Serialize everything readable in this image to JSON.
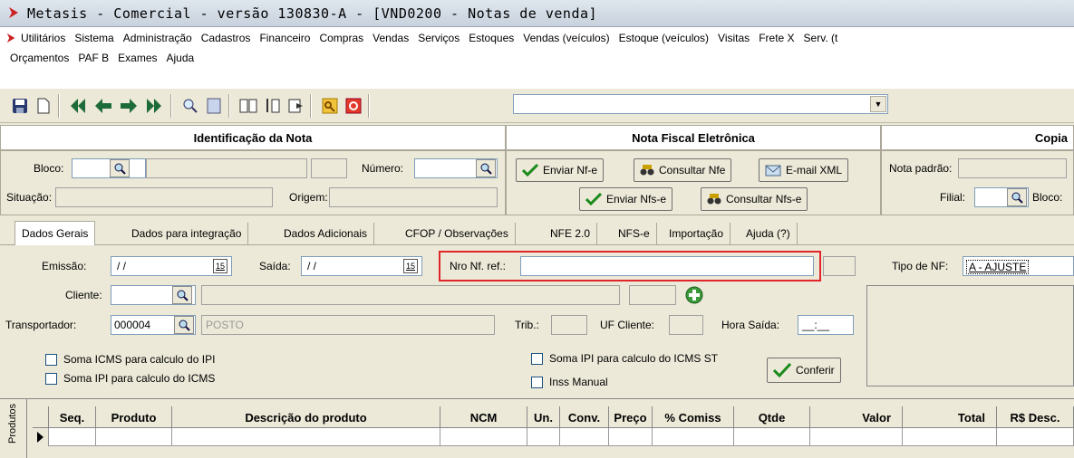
{
  "window": {
    "title": "Metasis - Comercial - versão 130830-A - [VND0200 - Notas de venda]"
  },
  "menu": {
    "row1": [
      "Utilitários",
      "Sistema",
      "Administração",
      "Cadastros",
      "Financeiro",
      "Compras",
      "Vendas",
      "Serviços",
      "Estoques",
      "Vendas (veículos)",
      "Estoque (veículos)",
      "Visitas",
      "Frete X",
      "Serv. (t"
    ],
    "row2": [
      "Orçamentos",
      "PAF B",
      "Exames",
      "Ajuda"
    ]
  },
  "toolbar": {
    "combo_value": ""
  },
  "sections": {
    "identificacao": "Identificação da Nota",
    "nfe": "Nota Fiscal Eletrônica",
    "copia": "Copia"
  },
  "identificacao": {
    "bloco_label": "Bloco:",
    "bloco_value": "",
    "numero_label": "Número:",
    "numero_value": "",
    "situacao_label": "Situação:",
    "situacao_value": "",
    "origem_label": "Origem:",
    "origem_value": ""
  },
  "nfe": {
    "enviar_nfe": "Enviar Nf-e",
    "consultar_nfe": "Consultar Nfe",
    "email_xml": "E-mail XML",
    "enviar_nfse": "Enviar Nfs-e",
    "consultar_nfse": "Consultar Nfs-e"
  },
  "copia": {
    "nota_padrao_label": "Nota padrão:",
    "filial_label": "Filial:",
    "bloco_label": "Bloco:"
  },
  "tabs": [
    "Dados Gerais",
    "Dados para integração",
    "Dados Adicionais",
    "CFOP / Observações",
    "NFE 2.0",
    "NFS-e",
    "Importação",
    "Ajuda (?)"
  ],
  "form": {
    "emissao_label": "Emissão:",
    "emissao_value": "/ /",
    "saida_label": "Saída:",
    "saida_value": "/ /",
    "nro_nf_ref_label": "Nro Nf. ref.:",
    "nro_nf_ref_value": "",
    "tipo_nf_label": "Tipo de NF:",
    "tipo_nf_value": "A - AJUSTE",
    "cliente_label": "Cliente:",
    "cliente_value": "",
    "transportador_label": "Transportador:",
    "transportador_code": "000004",
    "transportador_name": "POSTO",
    "trib_label": "Trib.:",
    "uf_cliente_label": "UF Cliente:",
    "hora_saida_label": "Hora Saída:",
    "hora_saida_value": "__:__",
    "date_btn": "15",
    "chk_soma_icms_ipi": "Soma ICMS para calculo do IPI",
    "chk_soma_ipi_icms": "Soma IPI para calculo do ICMS",
    "chk_soma_ipi_icms_st": "Soma IPI para calculo do ICMS ST",
    "chk_inss_manual": "Inss Manual",
    "conferir": "Conferir"
  },
  "grid": {
    "side_label": "Produtos",
    "columns": [
      "Seq.",
      "Produto",
      "Descrição do produto",
      "NCM",
      "Un.",
      "Conv.",
      "Preço",
      "% Comiss",
      "Qtde",
      "Valor",
      "Total",
      "R$ Desc."
    ]
  },
  "colors": {
    "highlight_border": "#e0262b",
    "titlebar": "#c8d2dd",
    "window_bg": "#ece9d8"
  }
}
